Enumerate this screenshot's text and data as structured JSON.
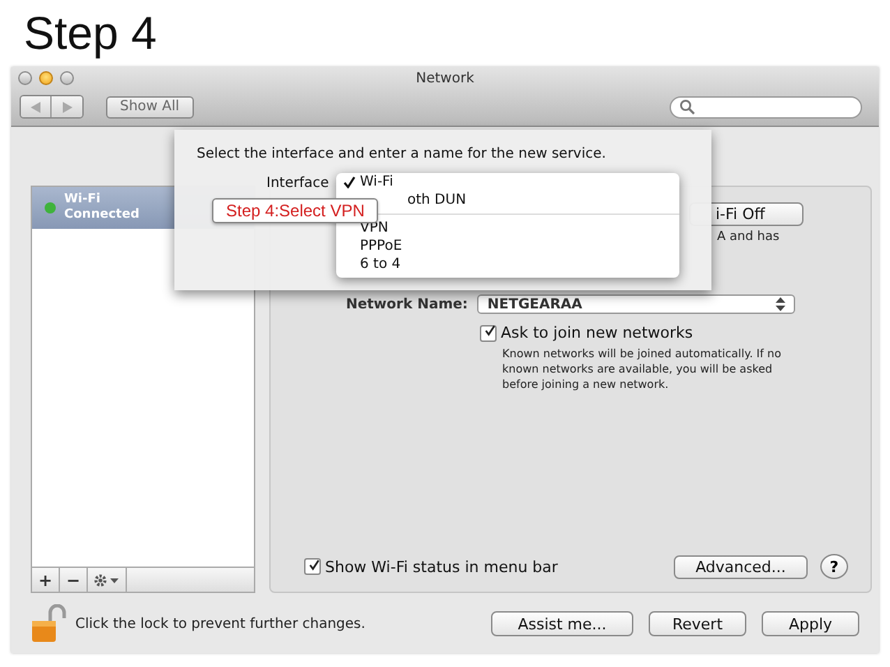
{
  "slide_title": "Step 4",
  "window": {
    "title": "Network",
    "show_all": "Show All"
  },
  "services": [
    {
      "name": "Wi-Fi",
      "status": "Connected",
      "selected": true,
      "color": "#3fb33c"
    }
  ],
  "service_buttons": [
    "+",
    "−"
  ],
  "panel": {
    "power_button": "i-Fi Off",
    "status_text": "A and has",
    "network_name_label": "Network Name:",
    "network_name": "NETGEARAA",
    "ask_join": {
      "label": "Ask to join new networks",
      "checked": true,
      "note": "Known networks will be joined automatically. If no known networks are available, you will be asked before joining a new network."
    },
    "show_status": {
      "label": "Show Wi-Fi status in menu bar",
      "checked": true
    },
    "advanced": "Advanced...",
    "help": "?"
  },
  "lock_text": "Click the lock to prevent further changes.",
  "footer_buttons": [
    "Assist me...",
    "Revert",
    "Apply"
  ],
  "sheet": {
    "prompt": "Select the interface and enter a name for the new service.",
    "interface_label": "Interface",
    "menu": [
      {
        "kind": "item",
        "label": "Wi-Fi",
        "checked": true
      },
      {
        "kind": "covered_item",
        "label": "oth DUN",
        "checked": false
      },
      {
        "kind": "separator"
      },
      {
        "kind": "item",
        "label": "VPN",
        "checked": false
      },
      {
        "kind": "item",
        "label": "PPPoE",
        "checked": false
      },
      {
        "kind": "item",
        "label": "6 to 4",
        "checked": false
      }
    ]
  },
  "callout": "Step 4:Select VPN"
}
